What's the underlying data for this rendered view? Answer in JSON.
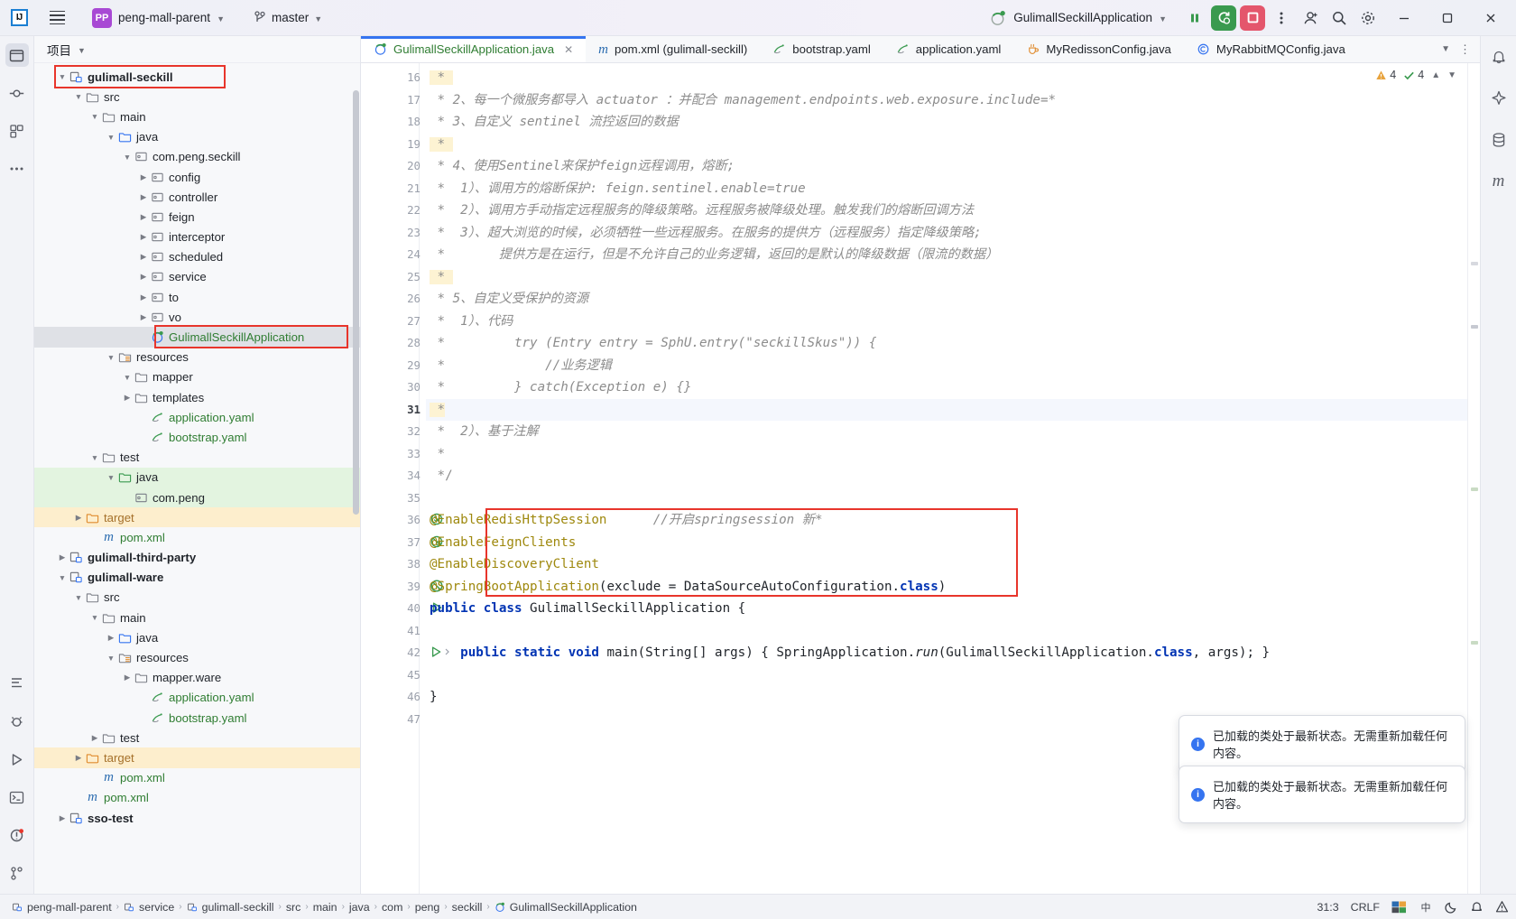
{
  "titlebar": {
    "logo": "intellij-idea-logo",
    "menu_icon": "hamburger-menu-icon",
    "project_badge": "PP",
    "project_name": "peng-mall-parent",
    "branch_name": "master",
    "run_config": "GulimallSeckillApplication",
    "buttons": {
      "pause": "pause-icon",
      "debug_reload": "reload-changed-classes-icon",
      "stop": "stop-icon",
      "more": "more-options-icon",
      "account": "account-icon",
      "search": "search-icon",
      "settings": "settings-icon",
      "minimize": "minimize",
      "maximize": "maximize",
      "close": "close"
    }
  },
  "project_panel": {
    "title": "项目",
    "tree": [
      {
        "indent": 1,
        "arrow": "down",
        "icon": "module",
        "label": "gulimall-seckill",
        "style": "bold",
        "highlight": "redbox"
      },
      {
        "indent": 2,
        "arrow": "down",
        "icon": "folder",
        "label": "src",
        "style": ""
      },
      {
        "indent": 3,
        "arrow": "down",
        "icon": "folder",
        "label": "main",
        "style": ""
      },
      {
        "indent": 4,
        "arrow": "down",
        "icon": "srcfolder",
        "label": "java",
        "style": ""
      },
      {
        "indent": 5,
        "arrow": "down",
        "icon": "package",
        "label": "com.peng.seckill",
        "style": ""
      },
      {
        "indent": 6,
        "arrow": "right",
        "icon": "package",
        "label": "config",
        "style": ""
      },
      {
        "indent": 6,
        "arrow": "right",
        "icon": "package",
        "label": "controller",
        "style": ""
      },
      {
        "indent": 6,
        "arrow": "right",
        "icon": "package",
        "label": "feign",
        "style": ""
      },
      {
        "indent": 6,
        "arrow": "right",
        "icon": "package",
        "label": "interceptor",
        "style": ""
      },
      {
        "indent": 6,
        "arrow": "right",
        "icon": "package",
        "label": "scheduled",
        "style": ""
      },
      {
        "indent": 6,
        "arrow": "right",
        "icon": "package",
        "label": "service",
        "style": ""
      },
      {
        "indent": 6,
        "arrow": "right",
        "icon": "package",
        "label": "to",
        "style": ""
      },
      {
        "indent": 6,
        "arrow": "right",
        "icon": "package",
        "label": "vo",
        "style": ""
      },
      {
        "indent": 6,
        "arrow": "none",
        "icon": "springapp",
        "label": "GulimallSeckillApplication",
        "style": "green",
        "row": "sel",
        "highlight": "redbox"
      },
      {
        "indent": 4,
        "arrow": "down",
        "icon": "resources",
        "label": "resources",
        "style": ""
      },
      {
        "indent": 5,
        "arrow": "down",
        "icon": "folder",
        "label": "mapper",
        "style": ""
      },
      {
        "indent": 5,
        "arrow": "right",
        "icon": "folder",
        "label": "templates",
        "style": ""
      },
      {
        "indent": 6,
        "arrow": "none",
        "icon": "yaml",
        "label": "application.yaml",
        "style": "green"
      },
      {
        "indent": 6,
        "arrow": "none",
        "icon": "yaml",
        "label": "bootstrap.yaml",
        "style": "green"
      },
      {
        "indent": 3,
        "arrow": "down",
        "icon": "folder",
        "label": "test",
        "style": ""
      },
      {
        "indent": 4,
        "arrow": "down",
        "icon": "testfolder",
        "label": "java",
        "style": "",
        "row": "green"
      },
      {
        "indent": 5,
        "arrow": "none",
        "icon": "package",
        "label": "com.peng",
        "style": "",
        "row": "green"
      },
      {
        "indent": 2,
        "arrow": "right",
        "icon": "targetfolder",
        "label": "target",
        "style": "amber",
        "row": "amber"
      },
      {
        "indent": 3,
        "arrow": "none",
        "icon": "maven",
        "label": "pom.xml",
        "style": "green"
      },
      {
        "indent": 1,
        "arrow": "right",
        "icon": "module",
        "label": "gulimall-third-party",
        "style": "bold"
      },
      {
        "indent": 1,
        "arrow": "down",
        "icon": "module",
        "label": "gulimall-ware",
        "style": "bold"
      },
      {
        "indent": 2,
        "arrow": "down",
        "icon": "folder",
        "label": "src",
        "style": ""
      },
      {
        "indent": 3,
        "arrow": "down",
        "icon": "folder",
        "label": "main",
        "style": ""
      },
      {
        "indent": 4,
        "arrow": "right",
        "icon": "srcfolder",
        "label": "java",
        "style": ""
      },
      {
        "indent": 4,
        "arrow": "down",
        "icon": "resources",
        "label": "resources",
        "style": ""
      },
      {
        "indent": 5,
        "arrow": "right",
        "icon": "folder",
        "label": "mapper.ware",
        "style": ""
      },
      {
        "indent": 6,
        "arrow": "none",
        "icon": "yaml",
        "label": "application.yaml",
        "style": "green"
      },
      {
        "indent": 6,
        "arrow": "none",
        "icon": "yaml",
        "label": "bootstrap.yaml",
        "style": "green"
      },
      {
        "indent": 3,
        "arrow": "right",
        "icon": "folder",
        "label": "test",
        "style": ""
      },
      {
        "indent": 2,
        "arrow": "right",
        "icon": "targetfolder",
        "label": "target",
        "style": "amber",
        "row": "amber"
      },
      {
        "indent": 3,
        "arrow": "none",
        "icon": "maven",
        "label": "pom.xml",
        "style": "green"
      },
      {
        "indent": 2,
        "arrow": "none",
        "icon": "maven",
        "label": "pom.xml",
        "style": "green"
      },
      {
        "indent": 1,
        "arrow": "right",
        "icon": "module",
        "label": "sso-test",
        "style": "bold"
      }
    ]
  },
  "editor": {
    "tabs": [
      {
        "label": "GulimallSeckillApplication.java",
        "icon": "spring-class-icon",
        "active": true,
        "closable": true
      },
      {
        "label": "pom.xml (gulimall-seckill)",
        "icon": "maven-icon",
        "active": false,
        "closable": false
      },
      {
        "label": "bootstrap.yaml",
        "icon": "yaml-icon",
        "active": false,
        "closable": false
      },
      {
        "label": "application.yaml",
        "icon": "yaml-icon",
        "active": false,
        "closable": false
      },
      {
        "label": "MyRedissonConfig.java",
        "icon": "java-class-icon",
        "active": false,
        "closable": false
      },
      {
        "label": "MyRabbitMQConfig.java",
        "icon": "config-class-icon",
        "active": false,
        "closable": false
      }
    ],
    "tab_overflow": "chevron-down-icon",
    "tab_options": "more-options-icon",
    "inspections": {
      "warnings": "4",
      "checks": "4"
    },
    "lines": [
      {
        "n": "16",
        "html": "<span class='hl-star cmt-b'> * </span>"
      },
      {
        "n": "17",
        "html": "<span class='cmt-b'> * </span><span class='cmt'>2、每一个微服务都导入 actuator ：并配合 management.endpoints.web.exposure.include=*</span>"
      },
      {
        "n": "18",
        "html": "<span class='cmt-b'> * </span><span class='cmt'>3、自定义 sentinel 流控返回的数据</span>"
      },
      {
        "n": "19",
        "html": "<span class='hl-star cmt-b'> * </span>"
      },
      {
        "n": "20",
        "html": "<span class='cmt-b'> * </span><span class='cmt'>4、使用Sentinel来保护feign远程调用，熔断;</span>"
      },
      {
        "n": "21",
        "html": "<span class='cmt-b'> * </span><span class='cmt'> 1）、调用方的熔断保护: feign.sentinel.enable=true</span>"
      },
      {
        "n": "22",
        "html": "<span class='cmt-b'> * </span><span class='cmt'> 2）、调用方手动指定远程服务的降级策略。远程服务被降级处理。触发我们的熔断回调方法</span>"
      },
      {
        "n": "23",
        "html": "<span class='cmt-b'> * </span><span class='cmt'> 3）、超大浏览的时候，必须牺牲一些远程服务。在服务的提供方（远程服务）指定降级策略;</span>"
      },
      {
        "n": "24",
        "html": "<span class='cmt-b'> * </span><span class='cmt'>      提供方是在运行，但是不允许自己的业务逻辑，返回的是默认的降级数据（限流的数据）</span>"
      },
      {
        "n": "25",
        "html": "<span class='hl-star cmt-b'> * </span>"
      },
      {
        "n": "26",
        "html": "<span class='cmt-b'> * </span><span class='cmt'>5、自定义受保护的资源</span>"
      },
      {
        "n": "27",
        "html": "<span class='cmt-b'> * </span><span class='cmt'> 1）、代码</span>"
      },
      {
        "n": "28",
        "html": "<span class='cmt-b'> * </span><span class='cmt'>        try (Entry entry = SphU.entry(\"seckillSkus\")) {</span>"
      },
      {
        "n": "29",
        "html": "<span class='cmt-b'> * </span><span class='cmt'>            //业务逻辑</span>"
      },
      {
        "n": "30",
        "html": "<span class='cmt-b'> * </span><span class='cmt'>        } catch(Exception e) {}</span>"
      },
      {
        "n": "31",
        "html": "<span class='hl-star cmt-b'> *</span>",
        "current": true
      },
      {
        "n": "32",
        "html": "<span class='cmt-b'> * </span><span class='cmt'> 2）、基于注解</span>"
      },
      {
        "n": "33",
        "html": "<span class='cmt-b'> * </span>"
      },
      {
        "n": "34",
        "html": "<span class='cmt-b'> */</span>"
      },
      {
        "n": "35",
        "html": ""
      },
      {
        "n": "36",
        "html": "<span class='ann'>@EnableRedisHttpSession</span>      <span class='cmt'>//开启springsession 新*</span>",
        "marker": "recompile"
      },
      {
        "n": "37",
        "html": "<span class='ann'>@EnableFeignClients</span>",
        "marker": "bean"
      },
      {
        "n": "38",
        "html": "<span class='ann'>@EnableDiscoveryClient</span>"
      },
      {
        "n": "39",
        "html": "<span class='ann'>@SpringBootApplication</span>(exclude = DataSourceAutoConfiguration.<span class='kw'>class</span>)",
        "marker": "bean2"
      },
      {
        "n": "40",
        "html": "<span class='kw'>public class</span> GulimallSeckillApplication {",
        "marker": "run"
      },
      {
        "n": "41",
        "html": ""
      },
      {
        "n": "42",
        "html": "    <span class='kw'>public static void</span> main(String[] args) { SpringApplication.<span class='ital'>run</span>(GulimallSeckillApplication.<span class='kw'>class</span>, args); }",
        "marker": "run-fold"
      },
      {
        "n": "45",
        "html": ""
      },
      {
        "n": "46",
        "html": "}"
      },
      {
        "n": "47",
        "html": ""
      }
    ]
  },
  "notifications": [
    {
      "icon": "info-icon",
      "text": "已加载的类处于最新状态。无需重新加载任何内容。"
    },
    {
      "icon": "info-icon",
      "text": "已加载的类处于最新状态。无需重新加载任何内容。"
    }
  ],
  "statusbar": {
    "breadcrumbs": [
      {
        "icon": "module-icon",
        "label": "peng-mall-parent"
      },
      {
        "icon": "module-icon",
        "label": "service"
      },
      {
        "icon": "module-icon",
        "label": "gulimall-seckill"
      },
      {
        "icon": "none",
        "label": "src"
      },
      {
        "icon": "none",
        "label": "main"
      },
      {
        "icon": "none",
        "label": "java"
      },
      {
        "icon": "none",
        "label": "com"
      },
      {
        "icon": "none",
        "label": "peng"
      },
      {
        "icon": "none",
        "label": "seckill"
      },
      {
        "icon": "spring-class-icon",
        "label": "GulimallSeckillApplication"
      }
    ],
    "caret": "31:3",
    "line_sep": "CRLF",
    "ime": "中",
    "right_icons": [
      "keyboard-layout-icon",
      "ime-chinese-icon",
      "theme-moon-icon",
      "notifications-icon",
      "warning-icon"
    ]
  },
  "left_rail": {
    "items": [
      "project-icon",
      "commit-icon",
      "structure-icon",
      "more-tool-windows-icon"
    ],
    "bottom": [
      "todo-icon",
      "problems-icon",
      "run-icon",
      "terminal-icon",
      "build-icon",
      "git-icon"
    ]
  },
  "right_rail": {
    "items": [
      "notifications-bell-icon",
      "ai-assistant-icon",
      "database-icon",
      "maven-m-icon"
    ]
  },
  "colors": {
    "accent": "#3574f0",
    "highlight_red": "#e8352b",
    "run_green": "#3a9a4f",
    "stop_red": "#e4566c",
    "annotation": "#9e880d",
    "keyword": "#0033b3",
    "comment": "#8c8c8c",
    "string": "#067d17"
  }
}
